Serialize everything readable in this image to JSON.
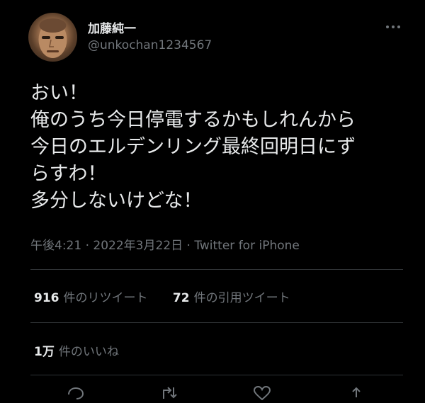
{
  "user": {
    "display_name": "加藤純一",
    "username": "@unkochan1234567"
  },
  "tweet": {
    "lines": [
      "おい！",
      "俺のうち今日停電するかもしれんから",
      "今日のエルデンリング最終回明日にず",
      "らすわ！",
      "多分しないけどな！"
    ],
    "timestamp": "午後4:21 · 2022年3月22日 · ",
    "source": "Twitter for iPhone"
  },
  "stats": {
    "retweets_count": "916",
    "retweets_label": "件のリツイート",
    "quotes_count": "72",
    "quotes_label": "件の引用ツイート",
    "likes_count": "1万",
    "likes_label": "件のいいね"
  },
  "icons": {
    "more": "more-horizontal-icon",
    "reply": "reply-icon",
    "retweet": "retweet-icon",
    "like": "like-icon",
    "share": "share-icon"
  },
  "colors": {
    "background": "#000000",
    "text_primary": "#e7e9ea",
    "text_secondary": "#71767b",
    "divider": "#2f3336"
  }
}
